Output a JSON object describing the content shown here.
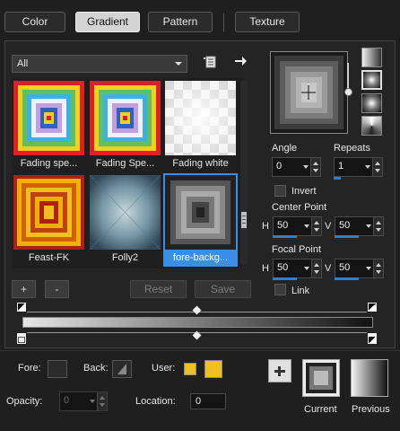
{
  "tabs": [
    "Color",
    "Gradient",
    "Pattern",
    "Texture"
  ],
  "active_tab": "Gradient",
  "category": "All",
  "presets": [
    {
      "name": "Fading spe...",
      "selected": false
    },
    {
      "name": "Fading Spe...",
      "selected": false
    },
    {
      "name": "Fading white",
      "selected": false
    },
    {
      "name": "Feast-FK",
      "selected": false
    },
    {
      "name": "Folly2",
      "selected": false
    },
    {
      "name": "fore-backg...",
      "selected": true
    }
  ],
  "buttons": {
    "add": "+",
    "remove": "-",
    "reset": "Reset",
    "save": "Save"
  },
  "angle": {
    "label": "Angle",
    "value": "0"
  },
  "repeats": {
    "label": "Repeats",
    "value": "1"
  },
  "invert": {
    "label": "Invert",
    "checked": false
  },
  "center_point": {
    "label": "Center Point",
    "h_label": "H",
    "h": "50",
    "v_label": "V",
    "v": "50"
  },
  "focal_point": {
    "label": "Focal Point",
    "h_label": "H",
    "h": "50",
    "v_label": "V",
    "v": "50"
  },
  "link": {
    "label": "Link",
    "checked": false
  },
  "fore": {
    "label": "Fore:",
    "color": "#2a2a2a"
  },
  "back": {
    "label": "Back:",
    "color": "#2a2a2a"
  },
  "user": {
    "label": "User:",
    "colors": [
      "#f0c020",
      "#f0c020"
    ]
  },
  "opacity": {
    "label": "Opacity:",
    "value": "0"
  },
  "location": {
    "label": "Location:",
    "value": "0"
  },
  "current_label": "Current",
  "previous_label": "Previous",
  "colors": {
    "accent": "#2d7fd4",
    "selected_bg": "#3a8ee6",
    "background": "#1f1f1f",
    "panel": "#262626"
  }
}
